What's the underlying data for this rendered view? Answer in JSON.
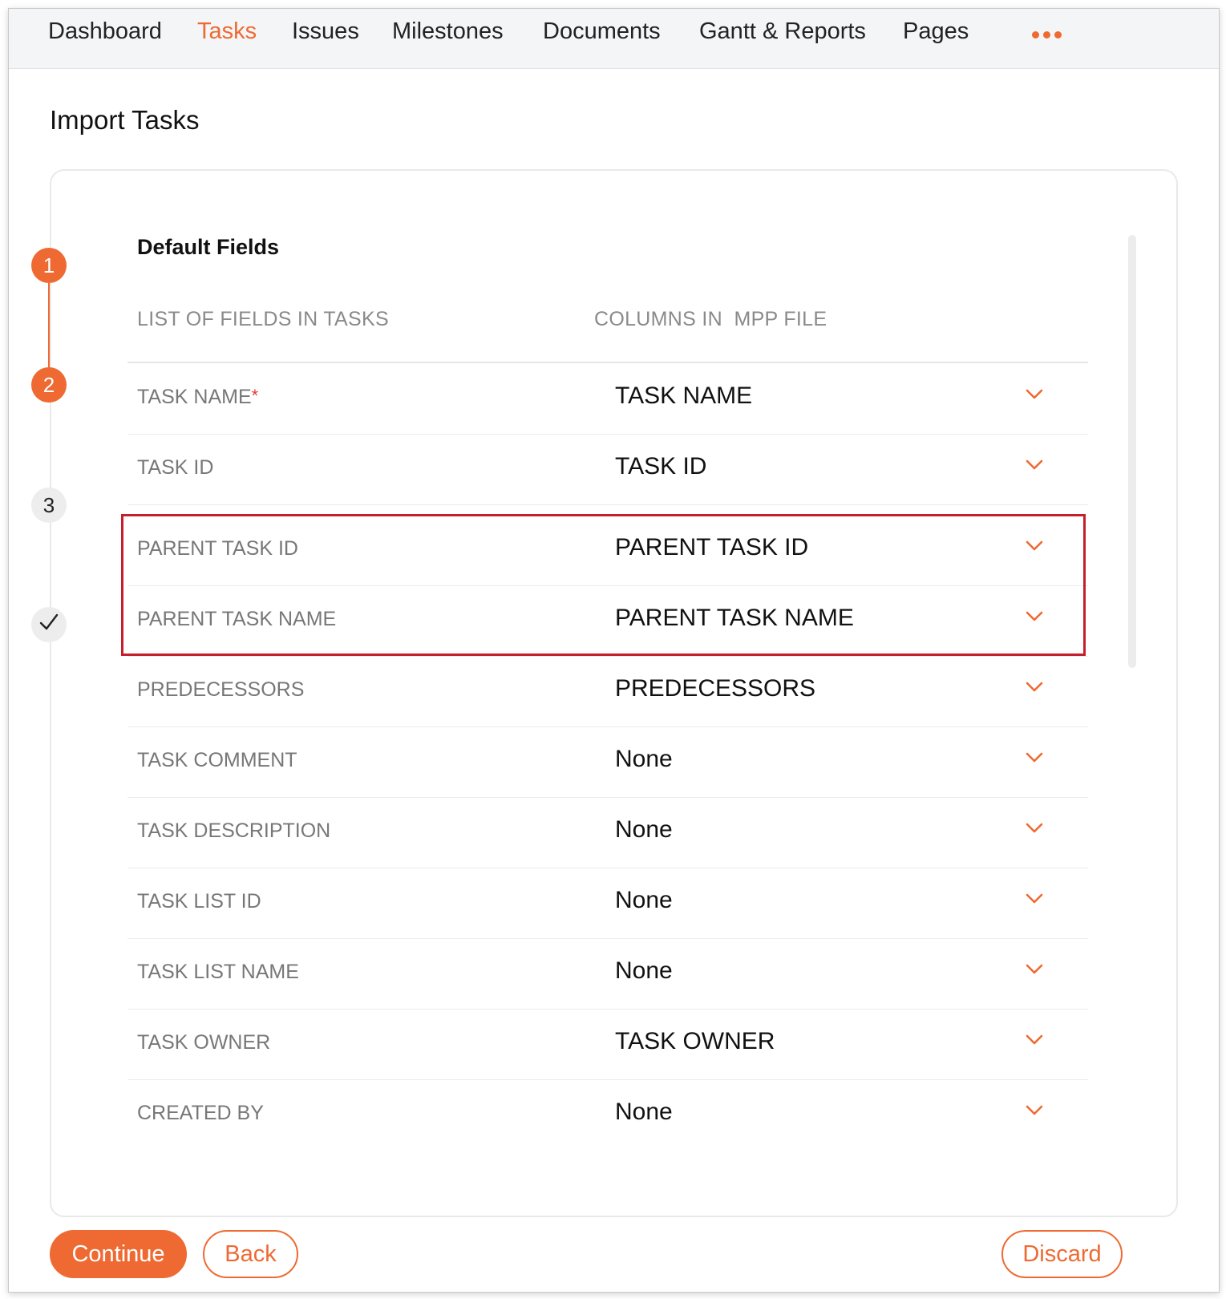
{
  "nav": {
    "items": [
      {
        "label": "Dashboard",
        "active": false
      },
      {
        "label": "Tasks",
        "active": true
      },
      {
        "label": "Issues",
        "active": false
      },
      {
        "label": "Milestones",
        "active": false
      },
      {
        "label": "Documents",
        "active": false
      },
      {
        "label": "Gantt & Reports",
        "active": false
      },
      {
        "label": "Pages",
        "active": false
      }
    ],
    "more_icon": "more-horizontal-icon"
  },
  "page": {
    "title": "Import Tasks"
  },
  "stepper": {
    "steps": [
      {
        "label": "1",
        "state": "done"
      },
      {
        "label": "2",
        "state": "done"
      },
      {
        "label": "3",
        "state": "pending"
      },
      {
        "label": "",
        "state": "pending",
        "icon": "checkmark-icon"
      }
    ]
  },
  "mapping": {
    "section_title": "Default Fields",
    "col_fields": "LIST OF FIELDS IN TASKS",
    "col_columns": "COLUMNS IN  MPP FILE",
    "rows": [
      {
        "field": "TASK NAME",
        "required": "*",
        "value": "TASK NAME"
      },
      {
        "field": "TASK ID",
        "value": "TASK ID"
      },
      {
        "field": "PARENT TASK ID",
        "value": "PARENT TASK ID"
      },
      {
        "field": "PARENT TASK NAME",
        "value": "PARENT TASK NAME"
      },
      {
        "field": "PREDECESSORS",
        "value": "PREDECESSORS"
      },
      {
        "field": "TASK COMMENT",
        "value": "None"
      },
      {
        "field": "TASK DESCRIPTION",
        "value": "None"
      },
      {
        "field": "TASK LIST ID",
        "value": "None"
      },
      {
        "field": "TASK LIST NAME",
        "value": "None"
      },
      {
        "field": "TASK OWNER",
        "value": "TASK OWNER"
      },
      {
        "field": "CREATED BY",
        "value": "None"
      }
    ],
    "highlighted_rows": [
      "PARENT TASK ID",
      "PARENT TASK NAME"
    ]
  },
  "footer": {
    "continue_label": "Continue",
    "back_label": "Back",
    "discard_label": "Discard"
  },
  "colors": {
    "accent": "#ee6a32",
    "highlight_border": "#c3202b",
    "required_mark": "#e23b3b"
  }
}
